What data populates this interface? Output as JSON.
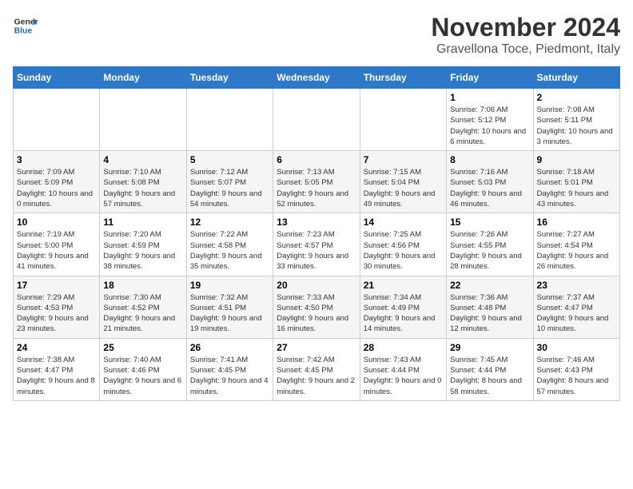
{
  "logo": {
    "general": "General",
    "blue": "Blue"
  },
  "header": {
    "month": "November 2024",
    "location": "Gravellona Toce, Piedmont, Italy"
  },
  "weekdays": [
    "Sunday",
    "Monday",
    "Tuesday",
    "Wednesday",
    "Thursday",
    "Friday",
    "Saturday"
  ],
  "weeks": [
    [
      {
        "day": "",
        "info": ""
      },
      {
        "day": "",
        "info": ""
      },
      {
        "day": "",
        "info": ""
      },
      {
        "day": "",
        "info": ""
      },
      {
        "day": "",
        "info": ""
      },
      {
        "day": "1",
        "info": "Sunrise: 7:06 AM\nSunset: 5:12 PM\nDaylight: 10 hours and 6 minutes."
      },
      {
        "day": "2",
        "info": "Sunrise: 7:08 AM\nSunset: 5:11 PM\nDaylight: 10 hours and 3 minutes."
      }
    ],
    [
      {
        "day": "3",
        "info": "Sunrise: 7:09 AM\nSunset: 5:09 PM\nDaylight: 10 hours and 0 minutes."
      },
      {
        "day": "4",
        "info": "Sunrise: 7:10 AM\nSunset: 5:08 PM\nDaylight: 9 hours and 57 minutes."
      },
      {
        "day": "5",
        "info": "Sunrise: 7:12 AM\nSunset: 5:07 PM\nDaylight: 9 hours and 54 minutes."
      },
      {
        "day": "6",
        "info": "Sunrise: 7:13 AM\nSunset: 5:05 PM\nDaylight: 9 hours and 52 minutes."
      },
      {
        "day": "7",
        "info": "Sunrise: 7:15 AM\nSunset: 5:04 PM\nDaylight: 9 hours and 49 minutes."
      },
      {
        "day": "8",
        "info": "Sunrise: 7:16 AM\nSunset: 5:03 PM\nDaylight: 9 hours and 46 minutes."
      },
      {
        "day": "9",
        "info": "Sunrise: 7:18 AM\nSunset: 5:01 PM\nDaylight: 9 hours and 43 minutes."
      }
    ],
    [
      {
        "day": "10",
        "info": "Sunrise: 7:19 AM\nSunset: 5:00 PM\nDaylight: 9 hours and 41 minutes."
      },
      {
        "day": "11",
        "info": "Sunrise: 7:20 AM\nSunset: 4:59 PM\nDaylight: 9 hours and 38 minutes."
      },
      {
        "day": "12",
        "info": "Sunrise: 7:22 AM\nSunset: 4:58 PM\nDaylight: 9 hours and 35 minutes."
      },
      {
        "day": "13",
        "info": "Sunrise: 7:23 AM\nSunset: 4:57 PM\nDaylight: 9 hours and 33 minutes."
      },
      {
        "day": "14",
        "info": "Sunrise: 7:25 AM\nSunset: 4:56 PM\nDaylight: 9 hours and 30 minutes."
      },
      {
        "day": "15",
        "info": "Sunrise: 7:26 AM\nSunset: 4:55 PM\nDaylight: 9 hours and 28 minutes."
      },
      {
        "day": "16",
        "info": "Sunrise: 7:27 AM\nSunset: 4:54 PM\nDaylight: 9 hours and 26 minutes."
      }
    ],
    [
      {
        "day": "17",
        "info": "Sunrise: 7:29 AM\nSunset: 4:53 PM\nDaylight: 9 hours and 23 minutes."
      },
      {
        "day": "18",
        "info": "Sunrise: 7:30 AM\nSunset: 4:52 PM\nDaylight: 9 hours and 21 minutes."
      },
      {
        "day": "19",
        "info": "Sunrise: 7:32 AM\nSunset: 4:51 PM\nDaylight: 9 hours and 19 minutes."
      },
      {
        "day": "20",
        "info": "Sunrise: 7:33 AM\nSunset: 4:50 PM\nDaylight: 9 hours and 16 minutes."
      },
      {
        "day": "21",
        "info": "Sunrise: 7:34 AM\nSunset: 4:49 PM\nDaylight: 9 hours and 14 minutes."
      },
      {
        "day": "22",
        "info": "Sunrise: 7:36 AM\nSunset: 4:48 PM\nDaylight: 9 hours and 12 minutes."
      },
      {
        "day": "23",
        "info": "Sunrise: 7:37 AM\nSunset: 4:47 PM\nDaylight: 9 hours and 10 minutes."
      }
    ],
    [
      {
        "day": "24",
        "info": "Sunrise: 7:38 AM\nSunset: 4:47 PM\nDaylight: 9 hours and 8 minutes."
      },
      {
        "day": "25",
        "info": "Sunrise: 7:40 AM\nSunset: 4:46 PM\nDaylight: 9 hours and 6 minutes."
      },
      {
        "day": "26",
        "info": "Sunrise: 7:41 AM\nSunset: 4:45 PM\nDaylight: 9 hours and 4 minutes."
      },
      {
        "day": "27",
        "info": "Sunrise: 7:42 AM\nSunset: 4:45 PM\nDaylight: 9 hours and 2 minutes."
      },
      {
        "day": "28",
        "info": "Sunrise: 7:43 AM\nSunset: 4:44 PM\nDaylight: 9 hours and 0 minutes."
      },
      {
        "day": "29",
        "info": "Sunrise: 7:45 AM\nSunset: 4:44 PM\nDaylight: 8 hours and 58 minutes."
      },
      {
        "day": "30",
        "info": "Sunrise: 7:46 AM\nSunset: 4:43 PM\nDaylight: 8 hours and 57 minutes."
      }
    ]
  ]
}
